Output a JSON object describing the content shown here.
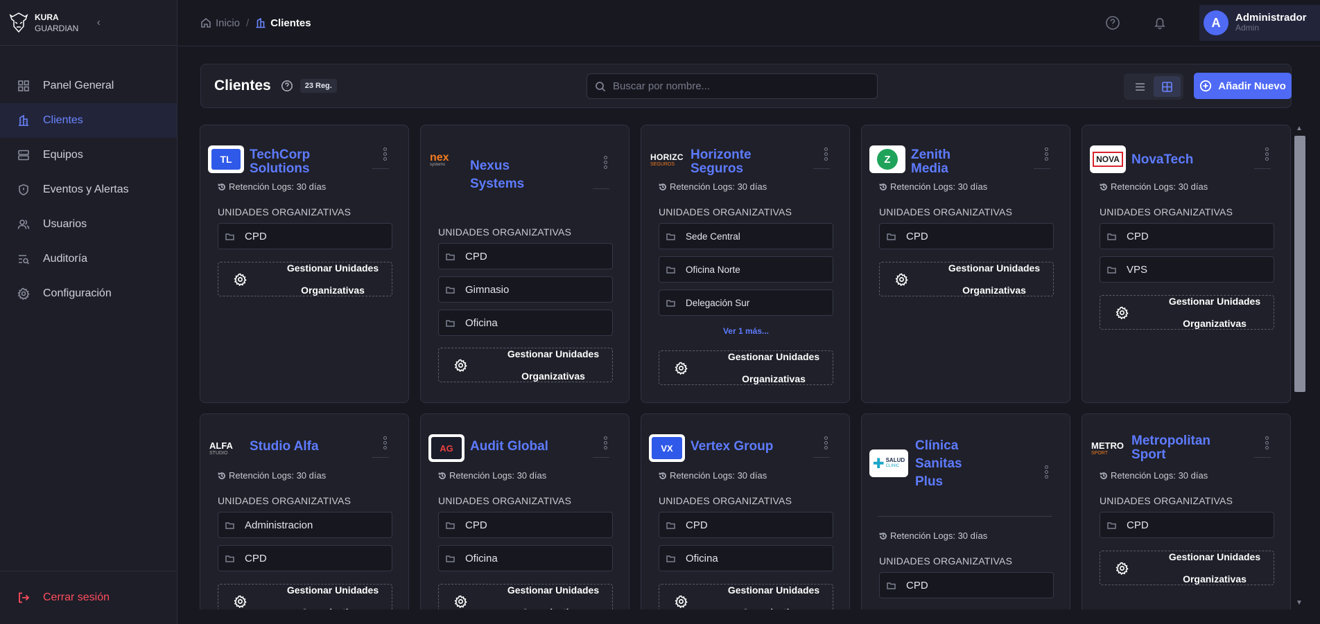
{
  "brand": {
    "line1": "KURA",
    "line2": "GUARDIAN"
  },
  "sidebar": {
    "items": [
      {
        "label": "Panel General",
        "icon": "grid-icon"
      },
      {
        "label": "Clientes",
        "icon": "building-icon",
        "active": true
      },
      {
        "label": "Equipos",
        "icon": "server-icon"
      },
      {
        "label": "Eventos y Alertas",
        "icon": "shield-alert-icon"
      },
      {
        "label": "Usuarios",
        "icon": "users-icon"
      },
      {
        "label": "Auditoría",
        "icon": "audit-list-icon"
      },
      {
        "label": "Configuración",
        "icon": "gear-icon"
      }
    ],
    "logout": "Cerrar sesión"
  },
  "breadcrumb": {
    "home": "Inicio",
    "sep": "/",
    "current": "Clientes"
  },
  "user": {
    "initial": "A",
    "name": "Administrador",
    "role": "Admin"
  },
  "page": {
    "title": "Clientes",
    "count": "23 Reg.",
    "search_placeholder": "Buscar por nombre...",
    "add_label": "Añadir Nuevo"
  },
  "labels": {
    "retention": "Retención Logs: 30 días",
    "section": "UNIDADES ORGANIZATIVAS",
    "manage_line1": "Gestionar Unidades",
    "manage_line2": "Organizativas"
  },
  "clients": [
    {
      "name1": "TechCorp",
      "name2": "Solutions",
      "logo": "TL",
      "units": [
        "CPD"
      ]
    },
    {
      "name1": "Nexus",
      "name2": "Systems",
      "logo": "nex",
      "logo_sub": "systems",
      "units": [
        "CPD",
        "Gimnasio",
        "Oficina"
      ]
    },
    {
      "name1": "Horizonte",
      "name2": "Seguros",
      "logo": "HORIZC",
      "logo_sub": "SEGUROS",
      "units": [
        "Sede Central",
        "Oficina Norte",
        "Delegación Sur"
      ],
      "more": "Ver 1 más..."
    },
    {
      "name1": "Zenith",
      "name2": "Media",
      "logo": "Z",
      "units": [
        "CPD"
      ]
    },
    {
      "name1": "NovaTech",
      "logo": "NOVA",
      "units": [
        "CPD",
        "VPS"
      ]
    },
    {
      "name1": "Studio Alfa",
      "logo": "ALFA",
      "logo_sub": "STUDIO",
      "units": [
        "Administracion",
        "CPD"
      ]
    },
    {
      "name1": "Audit Global",
      "logo": "AG",
      "units": [
        "CPD",
        "Oficina"
      ]
    },
    {
      "name1": "Vertex Group",
      "logo": "VX",
      "units": [
        "CPD",
        "Oficina"
      ]
    },
    {
      "name1": "Clínica",
      "name2": "Sanitas",
      "name3": "Plus",
      "logo": "SALUD",
      "logo_sub": "CLINIC",
      "units": [
        "CPD"
      ]
    },
    {
      "name1": "Metropolitan",
      "name2": "Sport",
      "logo": "METRO",
      "logo_sub": "SPORT",
      "units": [
        "CPD"
      ]
    }
  ],
  "colors": {
    "accent": "#4f6af5",
    "link": "#5e7bff",
    "danger": "#ff4d5e",
    "bg": "#171820"
  }
}
